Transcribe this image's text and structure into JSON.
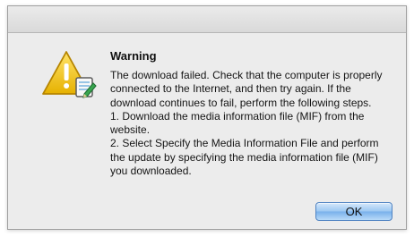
{
  "dialog": {
    "icon": "warning-icon",
    "title": "Warning",
    "message_lines": [
      "The download failed. Check that the computer is properly connected to the Internet, and then try again. If the download continues to fail, perform the following steps.",
      "1. Download the media information file (MIF) from the website.",
      "2. Select Specify the Media Information File and perform the update by specifying the media information file (MIF) you downloaded."
    ],
    "ok_label": "OK"
  },
  "colors": {
    "window_bg": "#ececec",
    "warning_yellow": "#f5cc19",
    "button_blue": "#8fc0f0"
  }
}
